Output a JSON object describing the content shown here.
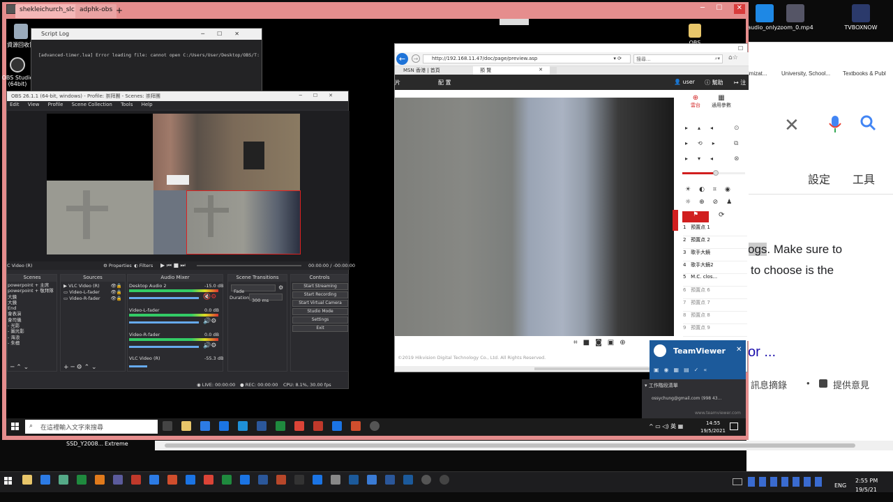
{
  "host_desktop": {
    "icons": [
      {
        "label": "audio_only...",
        "name": "audio-file-icon"
      },
      {
        "label": "zoom_0.mp4",
        "name": "video-file-icon"
      },
      {
        "label": "TVBOXNOW",
        "name": "tvboxnow-icon"
      }
    ],
    "bottom_labels": [
      "SSD_Y2008...",
      "Extreme"
    ],
    "clock": {
      "time": "2:55 PM",
      "date": "19/5/21",
      "lang": "ENG"
    }
  },
  "google_panel": {
    "bookmarks": [
      "imizat...",
      "University, School...",
      "Textbooks & Publ"
    ],
    "clear_icon": "close-icon",
    "settings_label": "設定",
    "tools_label": "工具",
    "snippet_line1_highlight": "ogs",
    "snippet_line1_rest": ". Make sure to",
    "snippet_line2": "to choose is the",
    "link_text": "or ...",
    "footer_left": "訊息摘錄",
    "footer_right": "提供意見"
  },
  "remote_window": {
    "tabs": [
      "shekleichurch_slc",
      "adphk-obs"
    ],
    "new_tab": "+",
    "desktop_icons": [
      {
        "label": "資源回收筒",
        "name": "recycle-bin-icon"
      },
      {
        "label": "OBS Studio (64bit)",
        "name": "obs-icon"
      },
      {
        "label": "OBS",
        "name": "folder-icon"
      }
    ]
  },
  "script_log": {
    "title": "Script Log",
    "message": "[advanced-timer.lua] Error loading file: cannot open C:/Users/User/Desktop/OBS/T:"
  },
  "obs": {
    "title": "OBS 26.1.1 (64-bit, windows) - Profile: 崇拜團 - Scenes: 崇拜團",
    "menu": [
      "Edit",
      "View",
      "Profile",
      "Scene Collection",
      "Tools",
      "Help"
    ],
    "source_bar": {
      "source": "C Video (R)",
      "properties": "Properties",
      "filters": "Filters",
      "time": "00:00:00 / -00:00:00"
    },
    "docks": {
      "scenes": {
        "title": "Scenes",
        "items": [
          "powerpoint + 主席",
          "powerpoint + 敬拜隊",
          "大鏡",
          "大鏡",
          "End",
          "會表演",
          "會司儀",
          "- 光影",
          "- 圖光影",
          "- 海浪",
          "- 朱檀"
        ]
      },
      "sources": {
        "title": "Sources",
        "items": [
          "VLC Video (R)",
          "Video-L-fader",
          "Video-R-fader"
        ]
      },
      "mixer": {
        "title": "Audio Mixer",
        "channels": [
          {
            "name": "Desktop Audio 2",
            "db": "-15.0 dB"
          },
          {
            "name": "Video-L-fader",
            "db": "0.0 dB"
          },
          {
            "name": "Video-R-fader",
            "db": "0.0 dB"
          },
          {
            "name": "VLC Video (R)",
            "db": "-55.3 dB"
          }
        ]
      },
      "transitions": {
        "title": "Scene Transitions",
        "type": "Fade",
        "duration_label": "Duration",
        "duration_value": "300 ms"
      },
      "controls": {
        "title": "Controls",
        "buttons": [
          "Start Streaming",
          "Start Recording",
          "Start Virtual Camera",
          "Studio Mode",
          "Settings",
          "Exit"
        ]
      }
    },
    "status": {
      "live": "LIVE: 00:00:00",
      "rec": "REC: 00:00:00",
      "cpu": "CPU: 8.1%, 30.00 fps"
    }
  },
  "ie": {
    "url": "http://192.168.11.47/doc/page/preview.asp",
    "search_placeholder": "搜尋...",
    "tabs": [
      "MSN 香港 | 首頁",
      "預 覽"
    ],
    "nav": {
      "left": "片",
      "config": "配 置",
      "user": "user",
      "help": "幫助",
      "logout": "注"
    },
    "ptz_tabs": [
      "雲台",
      "通用參數"
    ],
    "presets": [
      {
        "num": "1",
        "name": "預置点 1"
      },
      {
        "num": "2",
        "name": "預置点 2"
      },
      {
        "num": "3",
        "name": "歌手大鏡"
      },
      {
        "num": "4",
        "name": "歌手大鏡2"
      },
      {
        "num": "5",
        "name": "M.C. clos..."
      },
      {
        "num": "6",
        "name": "預置点 6"
      },
      {
        "num": "7",
        "name": "預置点 7"
      },
      {
        "num": "8",
        "name": "預置点 8"
      },
      {
        "num": "9",
        "name": "預置点 9"
      }
    ],
    "footer": "©2019 Hikvision Digital Technology Co., Ltd. All Rights Reserved."
  },
  "teamviewer": {
    "title": "TeamViewer",
    "section": "工作階段清單",
    "email": "ossychung@gmail.com (998 43...",
    "url": "www.teamviewer.com"
  },
  "remote_taskbar": {
    "search_placeholder": "在這裡輸入文字來搜尋",
    "clock_time": "14:55",
    "clock_date": "19/5/2021",
    "lang": "英"
  },
  "colors": {
    "obs_bg": "#2b2b2f",
    "remote_frame": "#e58d8d",
    "hikvision_red": "#d11f1f",
    "teamviewer_blue": "#1c5a9b"
  }
}
